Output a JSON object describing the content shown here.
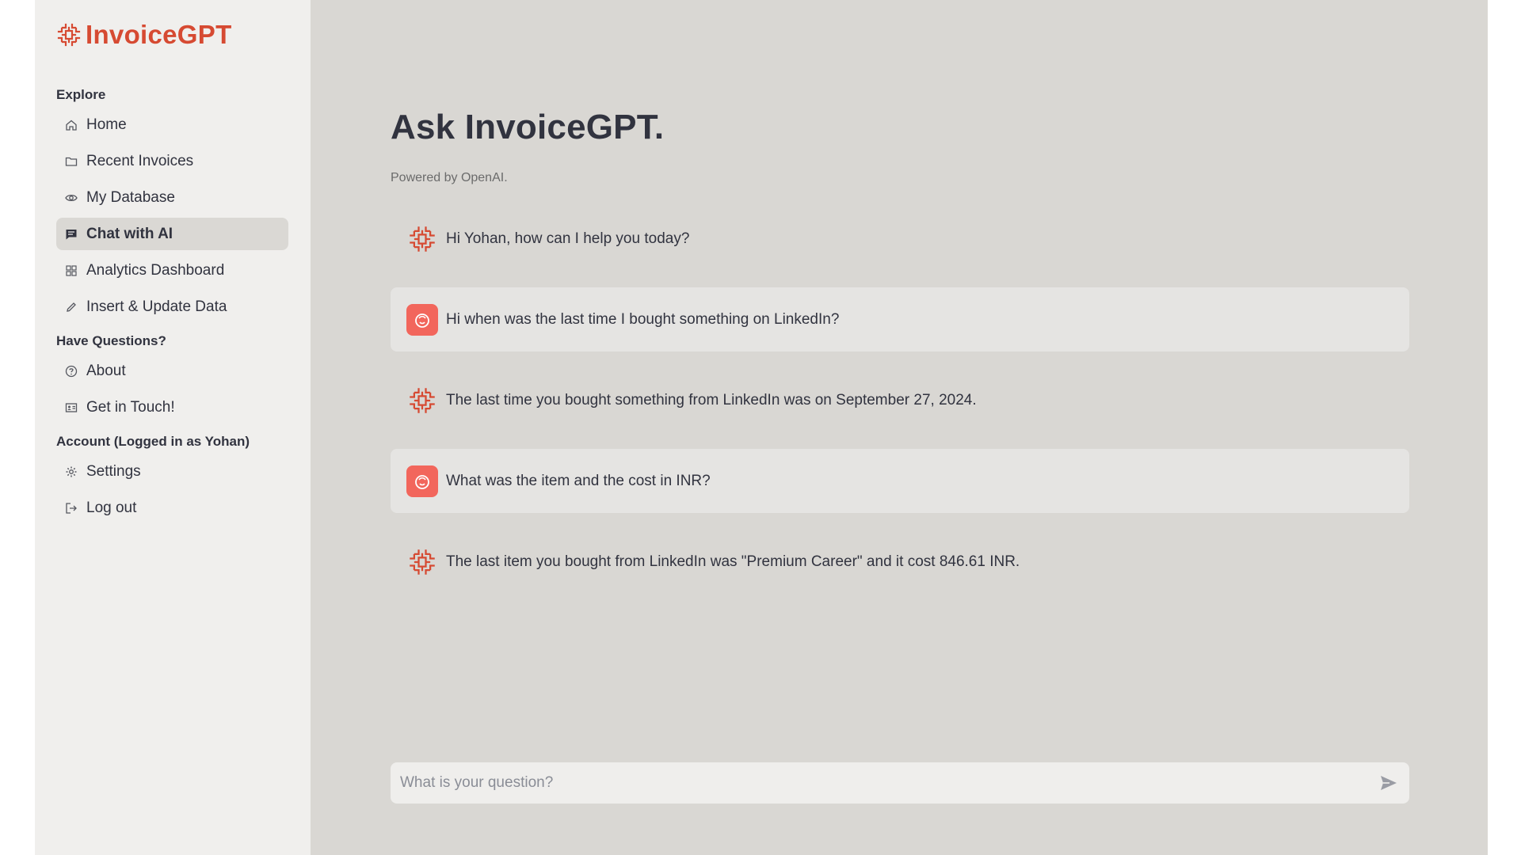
{
  "app": {
    "brand": "InvoiceGPT",
    "brand_color": "#d64a32",
    "accent_user_color": "#f2665c"
  },
  "sidebar": {
    "sections": [
      {
        "title": "Explore",
        "items": [
          {
            "label": "Home",
            "icon": "home-icon"
          },
          {
            "label": "Recent Invoices",
            "icon": "folder-icon"
          },
          {
            "label": "My Database",
            "icon": "eye-icon"
          },
          {
            "label": "Chat with AI",
            "icon": "chat-icon",
            "active": true
          },
          {
            "label": "Analytics Dashboard",
            "icon": "grid-icon"
          },
          {
            "label": "Insert & Update Data",
            "icon": "pencil-icon"
          }
        ]
      },
      {
        "title": "Have Questions?",
        "items": [
          {
            "label": "About",
            "icon": "help-circle-icon"
          },
          {
            "label": "Get in Touch!",
            "icon": "contact-card-icon"
          }
        ]
      },
      {
        "title": "Account (Logged in as Yohan)",
        "items": [
          {
            "label": "Settings",
            "icon": "gear-icon"
          },
          {
            "label": "Log out",
            "icon": "logout-icon"
          }
        ]
      }
    ]
  },
  "main": {
    "title": "Ask InvoiceGPT.",
    "subtitle": "Powered by OpenAI.",
    "messages": [
      {
        "role": "assistant",
        "text": "Hi Yohan, how can I help you today?"
      },
      {
        "role": "user",
        "text": "Hi when was the last time I bought something on LinkedIn?"
      },
      {
        "role": "assistant",
        "text": "The last time you bought something from LinkedIn was on September 27, 2024."
      },
      {
        "role": "user",
        "text": "What was the item and the cost in INR?"
      },
      {
        "role": "assistant",
        "text": "The last item you bought from LinkedIn was \"Premium Career\" and it cost 846.61 INR."
      }
    ],
    "input": {
      "placeholder": "What is your question?",
      "value": ""
    }
  }
}
